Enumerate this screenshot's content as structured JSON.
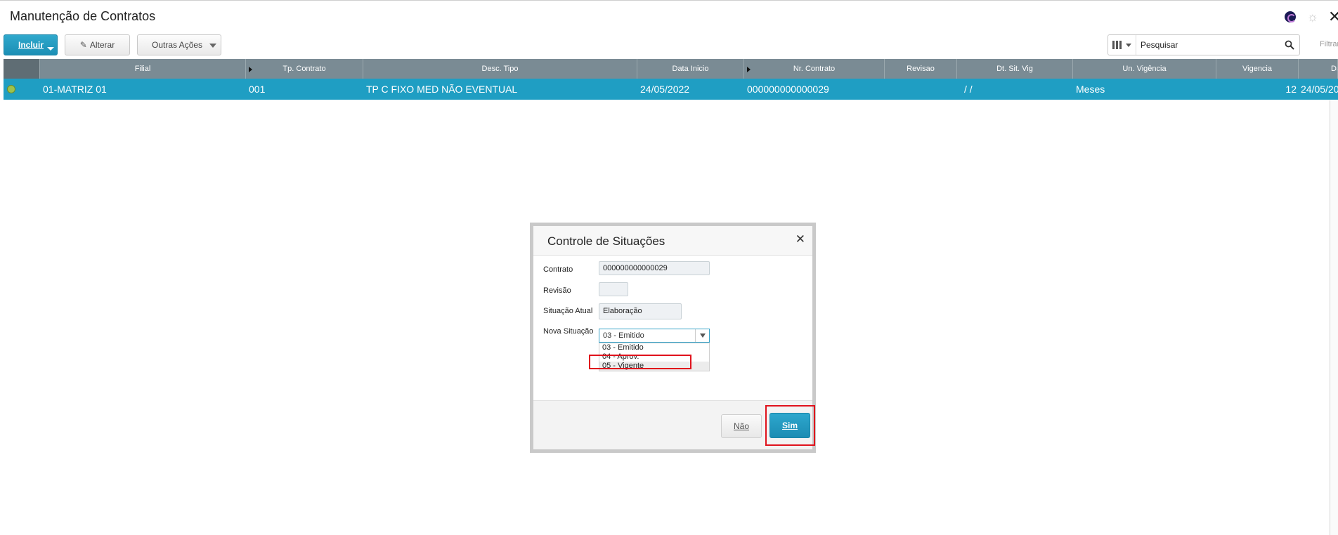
{
  "window": {
    "title": "Manutenção de Contratos"
  },
  "header_icons": [
    "app-logo-icon",
    "settings-icon",
    "close-icon"
  ],
  "toolbar": {
    "incluir_label": "Incluir",
    "alterar_label": "Alterar",
    "outras_label": "Outras Ações"
  },
  "search": {
    "placeholder": "Pesquisar",
    "filter_label": "Filtrar"
  },
  "grid": {
    "columns": [
      "",
      "Filial",
      "Tp. Contrato",
      "Desc. Tipo",
      "Data Inicio",
      "Nr. Contrato",
      "Revisao",
      "Dt. Sit. Vig",
      "Un. Vigência",
      "Vigencia",
      "Da"
    ],
    "rows": [
      {
        "status_color": "#9dc24d",
        "filial": "01-MATRIZ 01",
        "tp_contrato": "001",
        "desc_tipo": "TP C FIXO MED NÃO EVENTUAL",
        "data_inicio": "24/05/2022",
        "nr_contrato": "000000000000029",
        "revisao": "",
        "dt_sit_vig": "/ /",
        "un_vigencia": "Meses",
        "vigencia": "12",
        "data_fim": "24/05/20"
      }
    ]
  },
  "dialog": {
    "title": "Controle de Situações",
    "fields": {
      "contrato_label": "Contrato",
      "contrato_value": "000000000000029",
      "revisao_label": "Revisão",
      "revisao_value": "",
      "situacao_atual_label": "Situação Atual",
      "situacao_atual_value": "Elaboração",
      "nova_situacao_label": "Nova Situação",
      "nova_situacao_value": "03 - Emitido"
    },
    "options": [
      "03 - Emitido",
      "04 - Aprov.",
      "05 - Vigente"
    ],
    "highlighted_option": "05 - Vigente",
    "buttons": {
      "nao": "Não",
      "sim": "Sim"
    }
  },
  "colors": {
    "accent": "#1f9ec3",
    "header_gray": "#7a8b94",
    "highlight_red": "#e0121c"
  }
}
